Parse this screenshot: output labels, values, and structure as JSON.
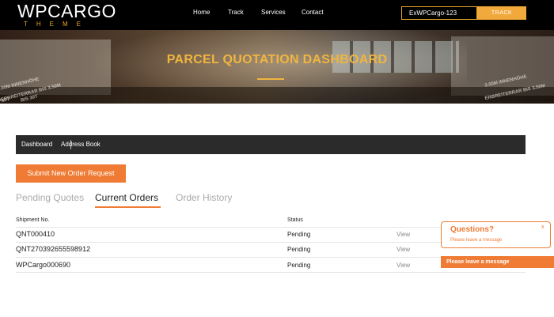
{
  "header": {
    "logo_main": "WPCARGO",
    "logo_sub": "THEME",
    "nav": [
      "Home",
      "Track",
      "Services",
      "Contact"
    ],
    "track_input_value": "ExWPCargo-123",
    "track_button": "TRACK"
  },
  "hero": {
    "title": "PARCEL QUOTATION DASHBOARD",
    "bg_texts": [
      "9.00M INNENHÖHE",
      "DERBREITERRAR BIS 3.50M",
      "MIT",
      "BIS 30T",
      "3.00M INNENHÖHE",
      "ERBREITERRAR BIS 3.50M"
    ]
  },
  "subnav": {
    "items": [
      "Dashboard",
      "Address Book"
    ]
  },
  "actions": {
    "submit_label": "Submit New Order Request"
  },
  "tabs": [
    {
      "label": "Pending Quotes",
      "active": false
    },
    {
      "label": "Current Orders",
      "active": true
    },
    {
      "label": "Order History",
      "active": false
    }
  ],
  "table": {
    "headers": [
      "Shipment No.",
      "Status"
    ],
    "rows": [
      {
        "shipment": "QNT000410",
        "status": "Pending",
        "action": "View"
      },
      {
        "shipment": "QNT270392655598912",
        "status": "Pending",
        "action": "View"
      },
      {
        "shipment": "WPCargo000690",
        "status": "Pending",
        "action": "View"
      }
    ]
  },
  "chat": {
    "title": "Questions?",
    "subtitle": "Please leave a message",
    "close": "x",
    "bar_label": "Please leave a message"
  },
  "colors": {
    "accent": "#f07b34",
    "gold": "#f1b53f",
    "dark_bar": "#2b2b2b"
  }
}
